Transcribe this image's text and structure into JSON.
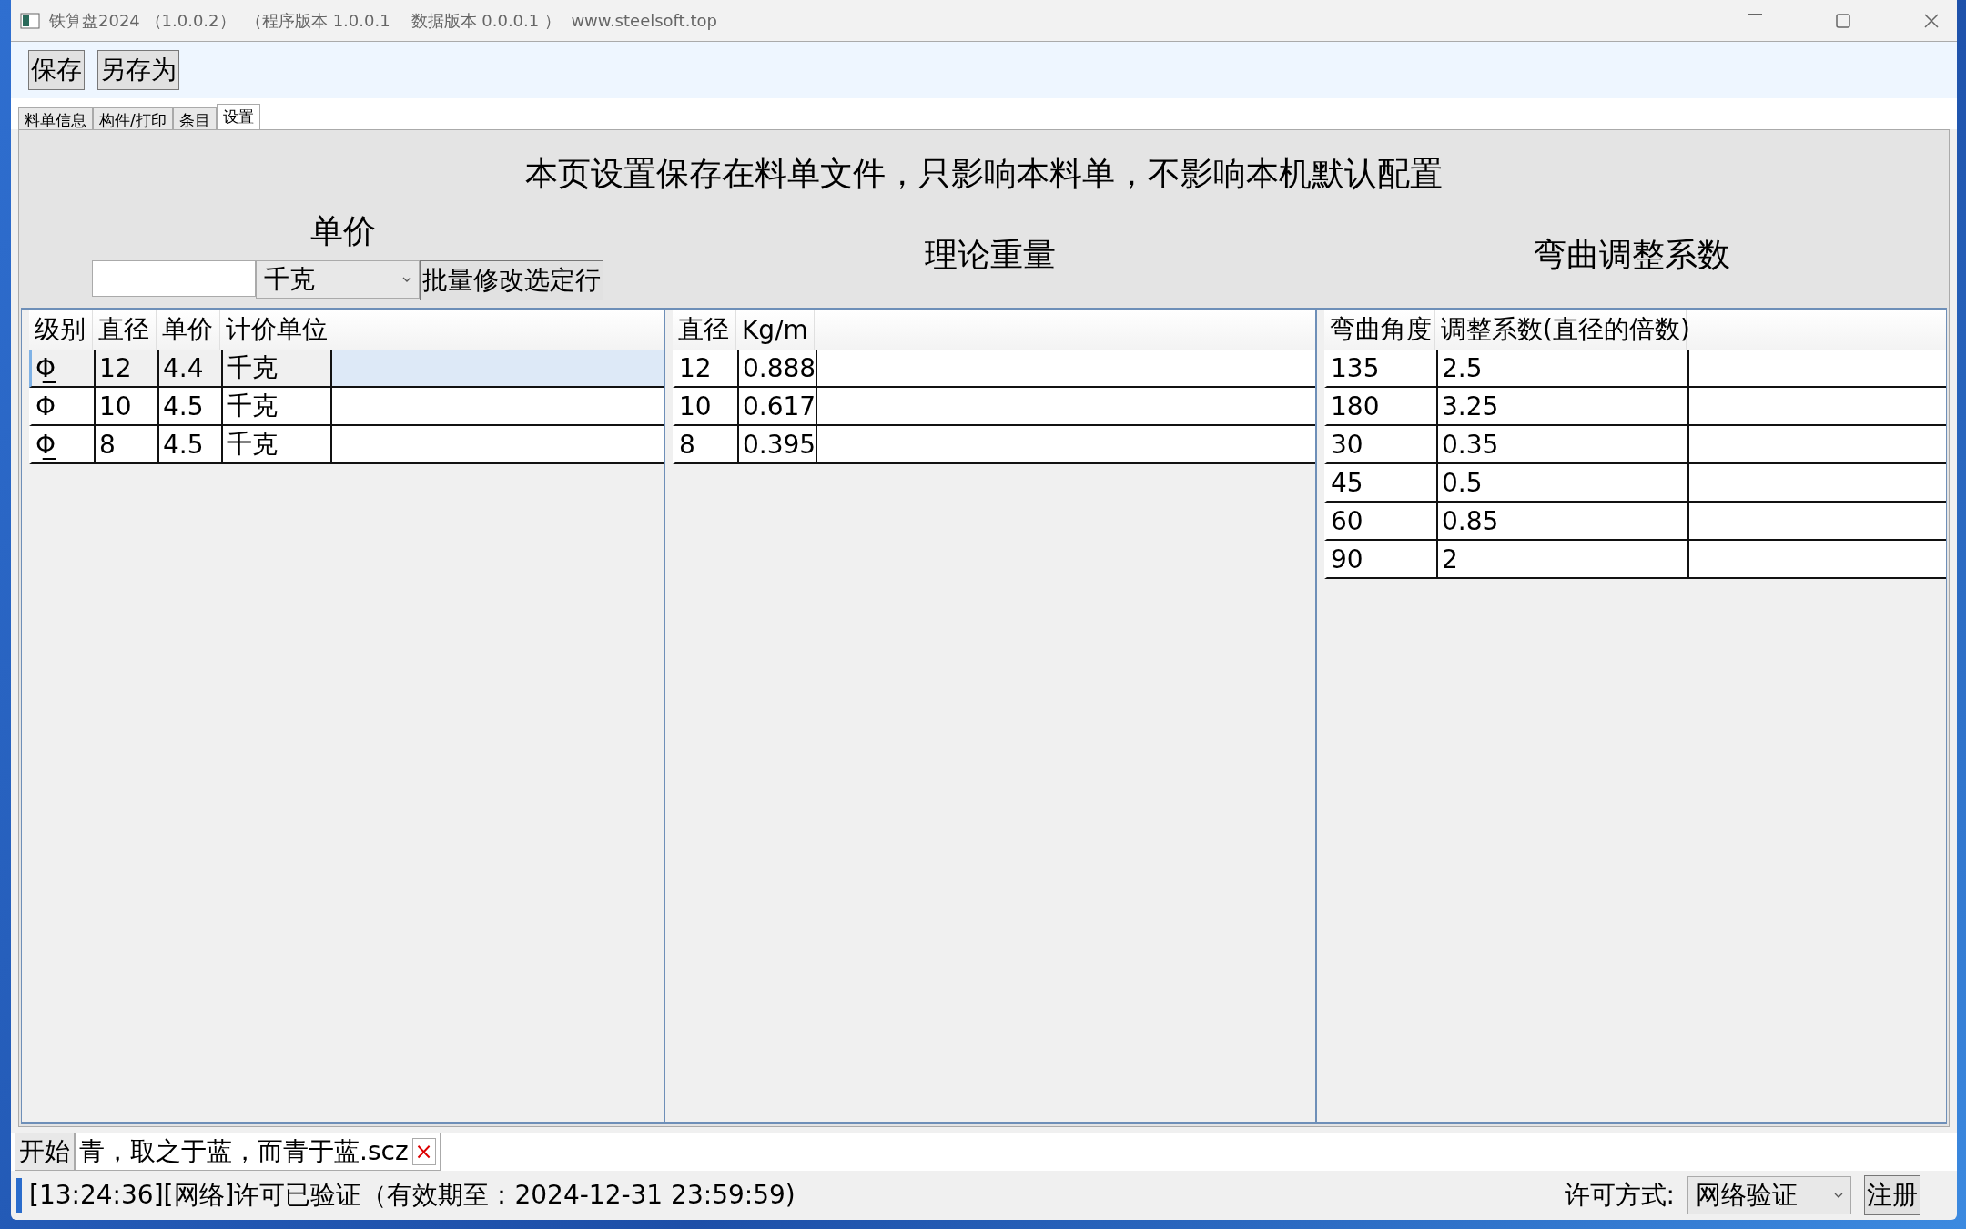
{
  "window": {
    "title": "铁算盘2024 （1.0.0.2）  （程序版本 1.0.0.1    数据版本 0.0.0.1 ）  www.steelsoft.top"
  },
  "toolbar": {
    "buttons": [
      "保存",
      "另存为"
    ]
  },
  "tabs": [
    {
      "label": "料单信息",
      "selected": false
    },
    {
      "label": "构件/打印",
      "selected": false
    },
    {
      "label": "条目",
      "selected": false
    },
    {
      "label": "设置",
      "selected": true
    }
  ],
  "notice": "本页设置保存在料单文件，只影响本料单，不影响本机默认配置",
  "price_panel": {
    "heading": "单价",
    "unit_select": "千克",
    "batch_button": "批量修改选定行",
    "columns": [
      "级别",
      "直径",
      "单价",
      "计价单位"
    ],
    "rows": [
      {
        "cells": [
          "Φ̲",
          "12",
          "4.4",
          "千克"
        ],
        "selected": true
      },
      {
        "cells": [
          "Φ",
          "10",
          "4.5",
          "千克"
        ],
        "selected": false
      },
      {
        "cells": [
          "Φ̲",
          "8",
          "4.5",
          "千克"
        ],
        "selected": false
      }
    ]
  },
  "weight_panel": {
    "heading": "理论重量",
    "columns": [
      "直径",
      "Kg/m"
    ],
    "rows": [
      [
        "12",
        "0.888"
      ],
      [
        "10",
        "0.617"
      ],
      [
        "8",
        "0.395"
      ]
    ]
  },
  "bend_panel": {
    "heading": "弯曲调整系数",
    "columns": [
      "弯曲角度",
      "调整系数(直径的倍数)"
    ],
    "rows": [
      [
        "135",
        "2.5"
      ],
      [
        "180",
        "3.25"
      ],
      [
        "30",
        "0.35"
      ],
      [
        "45",
        "0.5"
      ],
      [
        "60",
        "0.85"
      ],
      [
        "90",
        "2"
      ]
    ]
  },
  "doc_tabs": [
    {
      "label": "开始",
      "kind": "plain"
    },
    {
      "label": "青，取之于蓝，而青于蓝.scz",
      "kind": "file",
      "close": "×"
    }
  ],
  "status_bar": {
    "message": "[13:24:36][网络]许可已验证（有效期至：2024-12-31 23:59:59)",
    "license_label": "许可方式:",
    "license_select": "网络验证",
    "register_button": "注册"
  }
}
